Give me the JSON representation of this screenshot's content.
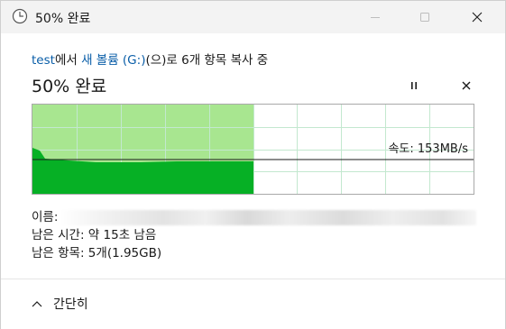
{
  "window": {
    "title": "50% 완료",
    "icon": "clock-icon"
  },
  "copy": {
    "source": "test",
    "source_suffix": "에서 ",
    "destination": "새 볼륨 (G:)",
    "destination_suffix": "(으)로 6개 항목 복사 중"
  },
  "progress": {
    "heading": "50% 완료",
    "percent": 50,
    "speed_label": "속도: 153MB/s"
  },
  "details": {
    "name_label": "이름:",
    "time_remaining": "남은 시간: 약 15초 남음",
    "items_remaining": "남은 항목: 5개(1.95GB)"
  },
  "footer": {
    "collapse_label": "간단히"
  },
  "colors": {
    "graph_done": "#a8e690",
    "graph_fill": "#06b025",
    "grid": "#c3e8cf",
    "link": "#0a5ea8"
  }
}
